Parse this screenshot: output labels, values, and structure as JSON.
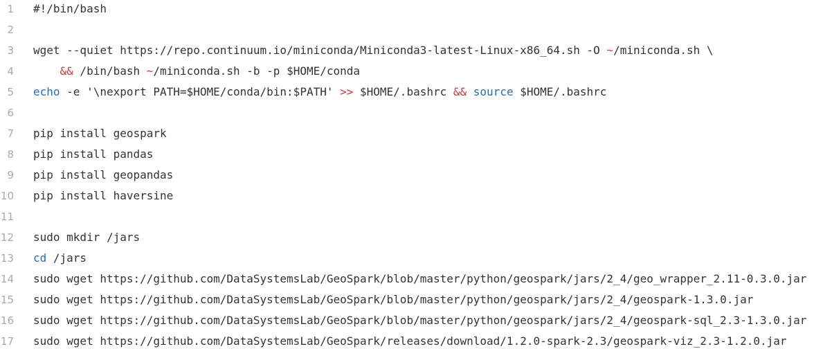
{
  "colors": {
    "background": "#ffffff",
    "line_number": "#a8a8a8",
    "text": "#333333",
    "keyword": "#1f6fba",
    "operator": "#d7333a"
  },
  "lines": [
    {
      "number": "1",
      "tokens": [
        {
          "t": "#!/bin/bash",
          "c": "plain"
        }
      ]
    },
    {
      "number": "2",
      "tokens": []
    },
    {
      "number": "3",
      "tokens": [
        {
          "t": "wget --quiet https://repo.continuum.io/miniconda/Miniconda3-latest-Linux-x86_64.sh -O ",
          "c": "plain"
        },
        {
          "t": "~",
          "c": "op"
        },
        {
          "t": "/miniconda.sh \\",
          "c": "plain"
        }
      ]
    },
    {
      "number": "4",
      "tokens": [
        {
          "t": "    ",
          "c": "plain"
        },
        {
          "t": "&&",
          "c": "op"
        },
        {
          "t": " /bin/bash ",
          "c": "plain"
        },
        {
          "t": "~",
          "c": "op"
        },
        {
          "t": "/miniconda.sh -b -p $HOME/conda",
          "c": "plain"
        }
      ]
    },
    {
      "number": "5",
      "tokens": [
        {
          "t": "echo",
          "c": "kw"
        },
        {
          "t": " -e '\\nexport PATH=$HOME/conda/bin:$PATH' ",
          "c": "plain"
        },
        {
          "t": ">>",
          "c": "op"
        },
        {
          "t": " $HOME/.bashrc ",
          "c": "plain"
        },
        {
          "t": "&&",
          "c": "op"
        },
        {
          "t": " ",
          "c": "plain"
        },
        {
          "t": "source",
          "c": "kw"
        },
        {
          "t": " $HOME/.bashrc",
          "c": "plain"
        }
      ]
    },
    {
      "number": "6",
      "tokens": []
    },
    {
      "number": "7",
      "tokens": [
        {
          "t": "pip install geospark",
          "c": "plain"
        }
      ]
    },
    {
      "number": "8",
      "tokens": [
        {
          "t": "pip install pandas",
          "c": "plain"
        }
      ]
    },
    {
      "number": "9",
      "tokens": [
        {
          "t": "pip install geopandas",
          "c": "plain"
        }
      ]
    },
    {
      "number": "10",
      "tokens": [
        {
          "t": "pip install haversine",
          "c": "plain"
        }
      ]
    },
    {
      "number": "11",
      "tokens": []
    },
    {
      "number": "12",
      "tokens": [
        {
          "t": "sudo mkdir /jars",
          "c": "plain"
        }
      ]
    },
    {
      "number": "13",
      "tokens": [
        {
          "t": "cd",
          "c": "kw"
        },
        {
          "t": " /jars",
          "c": "plain"
        }
      ]
    },
    {
      "number": "14",
      "tokens": [
        {
          "t": "sudo wget https://github.com/DataSystemsLab/GeoSpark/blob/master/python/geospark/jars/2_4/geo_wrapper_2.11-0.3.0.jar",
          "c": "plain"
        }
      ]
    },
    {
      "number": "15",
      "tokens": [
        {
          "t": "sudo wget https://github.com/DataSystemsLab/GeoSpark/blob/master/python/geospark/jars/2_4/geospark-1.3.0.jar",
          "c": "plain"
        }
      ]
    },
    {
      "number": "16",
      "tokens": [
        {
          "t": "sudo wget https://github.com/DataSystemsLab/GeoSpark/blob/master/python/geospark/jars/2_4/geospark-sql_2.3-1.3.0.jar",
          "c": "plain"
        }
      ]
    },
    {
      "number": "17",
      "tokens": [
        {
          "t": "sudo wget https://github.com/DataSystemsLab/GeoSpark/releases/download/1.2.0-spark-2.3/geospark-viz_2.3-1.2.0.jar",
          "c": "plain"
        }
      ]
    }
  ]
}
